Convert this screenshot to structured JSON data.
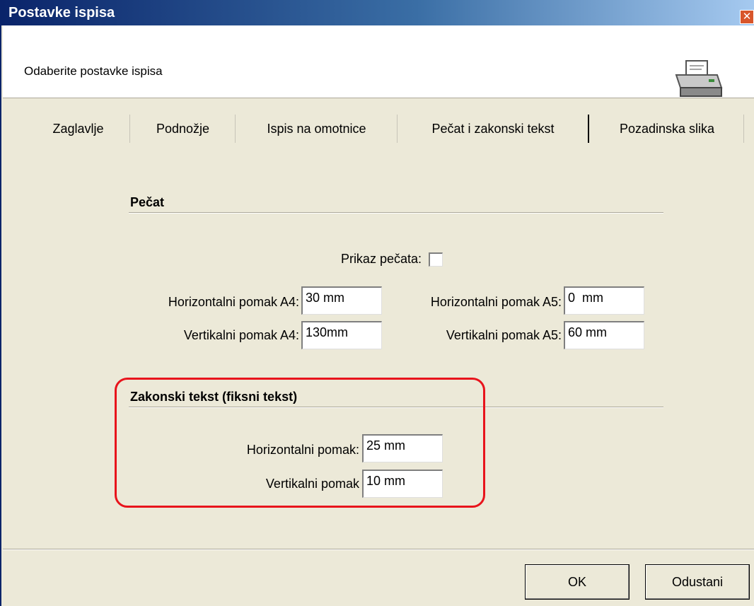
{
  "window": {
    "title": "Postavke ispisa"
  },
  "header": {
    "subtitle": "Odaberite postavke ispisa"
  },
  "icons": {
    "close": "close-icon",
    "printer": "printer-icon"
  },
  "tabs": [
    {
      "label": "Zaglavlje"
    },
    {
      "label": "Podnožje"
    },
    {
      "label": "Ispis na omotnice"
    },
    {
      "label": "Pečat i zakonski tekst",
      "active": true
    },
    {
      "label": "Pozadinska slika"
    }
  ],
  "pecat": {
    "title": "Pečat",
    "show_label": "Prikaz pečata:",
    "show_checked": false,
    "h_a4_label": "Horizontalni pomak A4:",
    "h_a4_value": "30 mm",
    "v_a4_label": "Vertikalni pomak A4:",
    "v_a4_value": "130mm",
    "h_a5_label": "Horizontalni pomak A5:",
    "h_a5_value": "0  mm",
    "v_a5_label": "Vertikalni pomak A5:",
    "v_a5_value": "60 mm"
  },
  "zakonski": {
    "title": "Zakonski tekst (fiksni tekst)",
    "h_label": "Horizontalni pomak:",
    "h_value": "25 mm",
    "v_label": "Vertikalni pomak",
    "v_value": "10 mm"
  },
  "buttons": {
    "ok": "OK",
    "cancel": "Odustani"
  },
  "colors": {
    "highlight": "#e8141c",
    "title_bar": "#0a246a",
    "background": "#ece9d8"
  }
}
